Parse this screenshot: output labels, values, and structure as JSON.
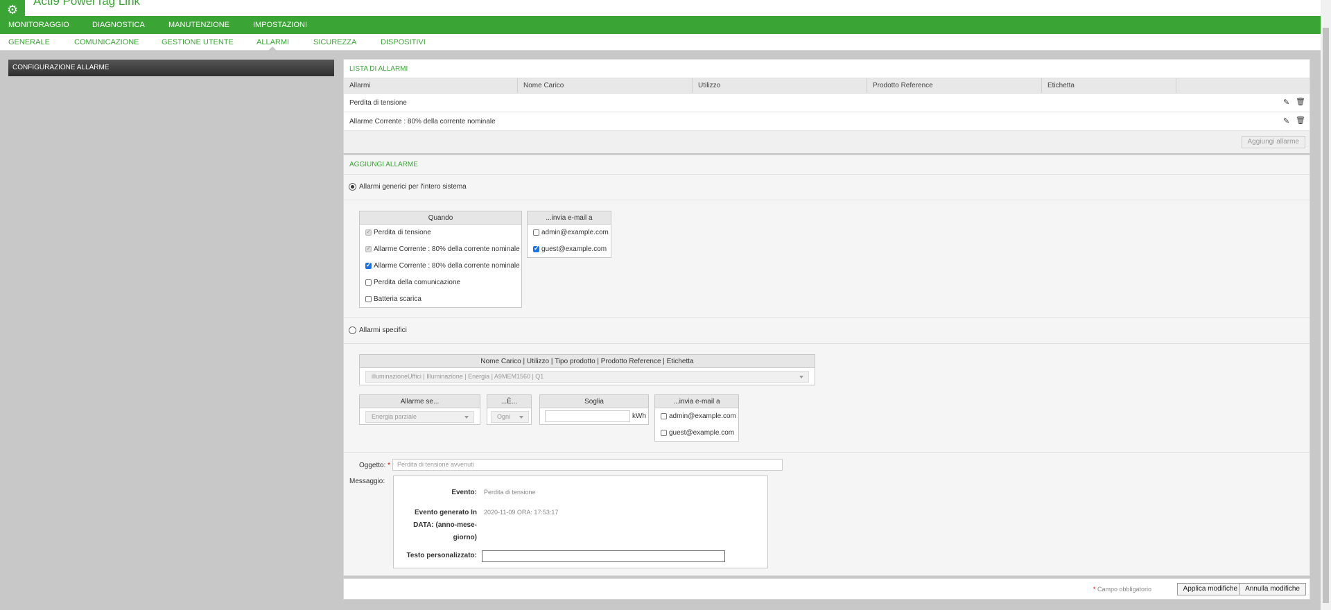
{
  "app": {
    "title": "Acti9 PowerTag Link",
    "logo_icon": "gear-icon"
  },
  "main_nav": [
    "MONITORAGGIO",
    "DIAGNOSTICA",
    "MANUTENZIONE",
    "IMPOSTAZIONI"
  ],
  "sub_nav": [
    "GENERALE",
    "COMUNICAZIONE",
    "GESTIONE UTENTE",
    "ALLARMI",
    "SICUREZZA",
    "DISPOSITIVI"
  ],
  "active_sub_nav": "ALLARMI",
  "left_panel": {
    "title": "CONFIGURAZIONE ALLARME"
  },
  "lista": {
    "title": "LISTA DI ALLARMI",
    "columns": [
      "Allarmi",
      "Nome Carico",
      "Utilizzo",
      "Prodotto Reference",
      "Etichetta",
      ""
    ],
    "rows": [
      {
        "allarme": "Perdita di tensione"
      },
      {
        "allarme": "Allarme Corrente : 80% della corrente nominale"
      }
    ],
    "add_button": "Aggiungi allarme"
  },
  "aggiungi": {
    "title": "AGGIUNGI ALLARME",
    "radio_generic": "Allarmi generici per l'intero sistema",
    "radio_specific": "Allarmi specifici",
    "quando": {
      "header": "Quando",
      "items": [
        {
          "label": "Perdita di tensione",
          "state": "disabled"
        },
        {
          "label": "Allarme Corrente : 80% della corrente nominale",
          "state": "disabled"
        },
        {
          "label": "Allarme Corrente : 80% della corrente nominale",
          "state": "checked"
        },
        {
          "label": "Perdita della comunicazione",
          "state": "unchecked"
        },
        {
          "label": "Batteria scarica",
          "state": "unchecked"
        }
      ]
    },
    "email_generic": {
      "header": "...invia e-mail a",
      "items": [
        {
          "label": "admin@example.com",
          "state": "unchecked"
        },
        {
          "label": "guest@example.com",
          "state": "checked"
        }
      ]
    },
    "specific": {
      "carico_header": "Nome Carico | Utilizzo | Tipo prodotto | Prodotto Reference | Etichetta",
      "carico_value": "illuminazioneUffici | Illuminazione | Energia | A9MEM1560 | Q1",
      "allarme_se_header": "Allarme se...",
      "allarme_se_value": "Energia parziale",
      "e_header": "...È...",
      "e_value": "Ogni",
      "soglia_header": "Soglia",
      "soglia_value": "",
      "soglia_unit": "kWh",
      "email_header": "...invia e-mail a",
      "emails": [
        "admin@example.com",
        "guest@example.com"
      ]
    },
    "oggetto_label": "Oggetto:",
    "oggetto_placeholder": "Perdita di tensione avvenuti",
    "messaggio_label": "Messaggio:",
    "evento_label": "Evento:",
    "evento_value": "Perdita di tensione",
    "generato_label": "Evento generato In DATA: (anno-mese-giorno)",
    "generato_value": "2020-11-09 ORA: 17:53:17",
    "testo_label": "Testo personalizzato:",
    "testo_value": ""
  },
  "footer": {
    "required_note": "Campo obbligatorio",
    "apply_button": "Applica modifiche",
    "cancel_button": "Annulla modifiche"
  },
  "colors": {
    "brand_green": "#3aa535",
    "checkbox_blue": "#1a73e8"
  }
}
